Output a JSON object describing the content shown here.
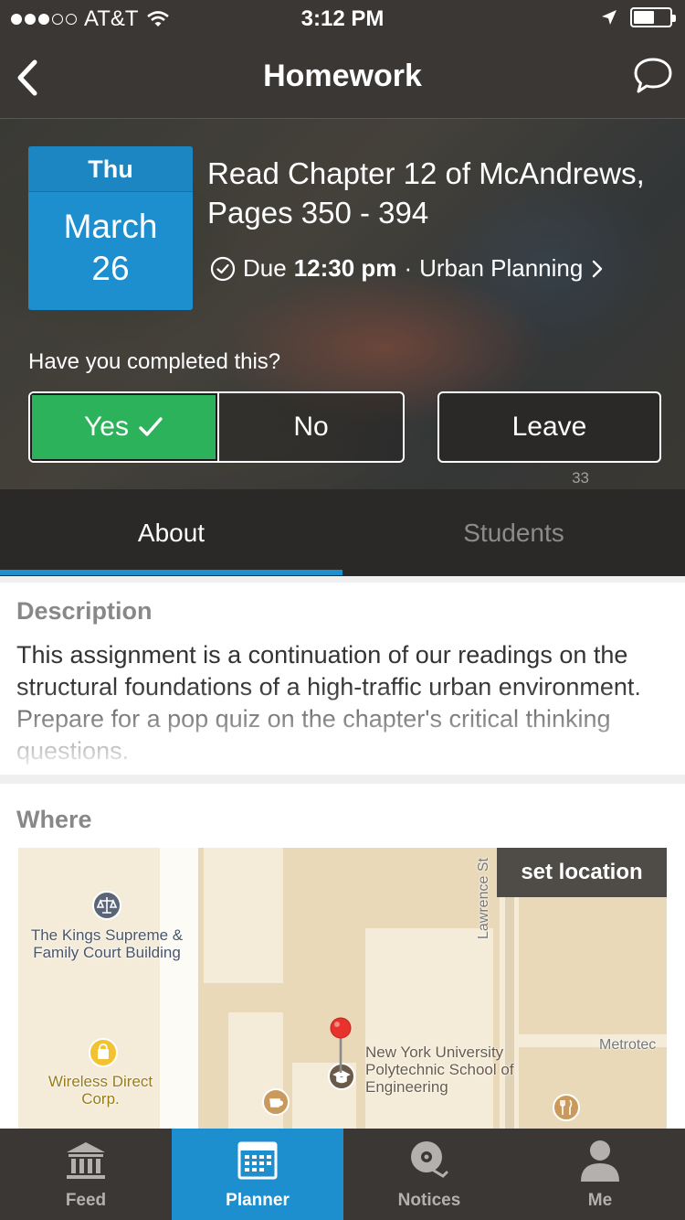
{
  "status_bar": {
    "carrier": "AT&T",
    "time": "3:12 PM"
  },
  "nav": {
    "title": "Homework"
  },
  "assignment": {
    "day_of_week": "Thu",
    "month": "March",
    "day": "26",
    "title": "Read Chapter 12 of McAndrews, Pages 350 - 394",
    "due_prefix": "Due",
    "due_time": "12:30 pm",
    "separator": "·",
    "course": "Urban Planning"
  },
  "completion": {
    "question": "Have you completed this?",
    "yes_label": "Yes",
    "no_label": "No",
    "leave_label": "Leave",
    "selected": "Yes"
  },
  "tabs": [
    {
      "label": "About",
      "active": true
    },
    {
      "label": "Students",
      "count": "33",
      "active": false
    }
  ],
  "description": {
    "title": "Description",
    "text": "This assignment is a continuation of our readings on the structural foundations of a high-traffic urban environment. Prepare for a pop quiz on the chapter's critical thinking questions."
  },
  "where": {
    "title": "Where",
    "set_location_label": "set location",
    "map_labels": {
      "court": "The Kings Supreme & Family Court Building",
      "wireless": "Wireless Direct Corp.",
      "nyu": "New York University Polytechnic School of Engineering",
      "street": "Lawrence St",
      "metrotech": "Metrotec"
    }
  },
  "tab_bar": [
    {
      "label": "Feed",
      "icon": "bank-icon",
      "active": false
    },
    {
      "label": "Planner",
      "icon": "calendar-icon",
      "active": true
    },
    {
      "label": "Notices",
      "icon": "bell-icon",
      "active": false
    },
    {
      "label": "Me",
      "icon": "person-icon",
      "active": false
    }
  ],
  "colors": {
    "accent": "#1e8fce",
    "success": "#2bb25b",
    "bar_dark": "#3a3735"
  }
}
